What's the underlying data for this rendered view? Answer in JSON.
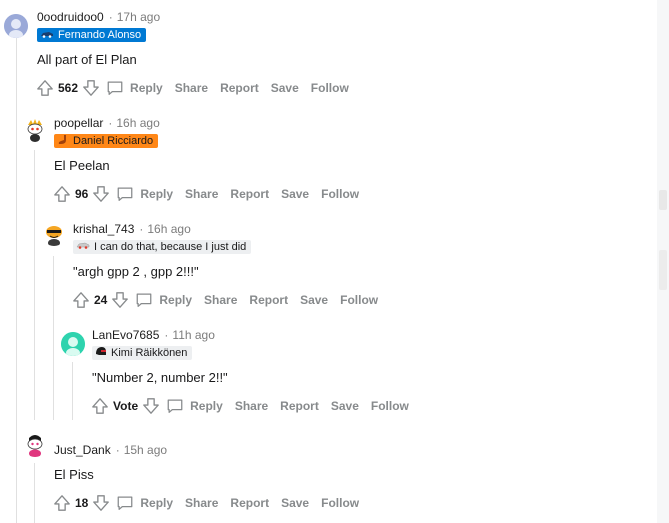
{
  "colors": {
    "flair_blue": "#0079d3",
    "flair_orange": "#ff8717",
    "flair_grey": "#edeff1",
    "thread_line": "#e0e0e0",
    "action_text": "#878a8c"
  },
  "comments": [
    {
      "username": "0oodruidoo0",
      "time": "17h ago",
      "flair": "Fernando Alonso",
      "flair_icon": "car-icon",
      "body": "All part of El Plan",
      "votes": "562",
      "actions": [
        "Reply",
        "Share",
        "Report",
        "Save",
        "Follow"
      ]
    },
    {
      "username": "poopellar",
      "time": "16h ago",
      "flair": "Daniel Ricciardo",
      "flair_icon": "shoey-icon",
      "body": "El Peelan",
      "votes": "96",
      "actions": [
        "Reply",
        "Share",
        "Report",
        "Save",
        "Follow"
      ]
    },
    {
      "username": "krishal_743",
      "time": "16h ago",
      "flair": "I can do that, because I just did",
      "flair_icon": "car-icon",
      "body": "\"argh gpp 2 , gpp 2!!!\"",
      "votes": "24",
      "actions": [
        "Reply",
        "Share",
        "Report",
        "Save",
        "Follow"
      ]
    },
    {
      "username": "LanEvo7685",
      "time": "11h ago",
      "flair": "Kimi Räikkönen",
      "flair_icon": "helmet-icon",
      "body": "\"Number 2, number 2!!\"",
      "votes": "Vote",
      "actions": [
        "Reply",
        "Share",
        "Report",
        "Save",
        "Follow"
      ]
    },
    {
      "username": "Just_Dank",
      "time": "15h ago",
      "flair": "",
      "body": "El Piss",
      "votes": "18",
      "actions": [
        "Reply",
        "Share",
        "Report",
        "Save",
        "Follow"
      ]
    }
  ]
}
